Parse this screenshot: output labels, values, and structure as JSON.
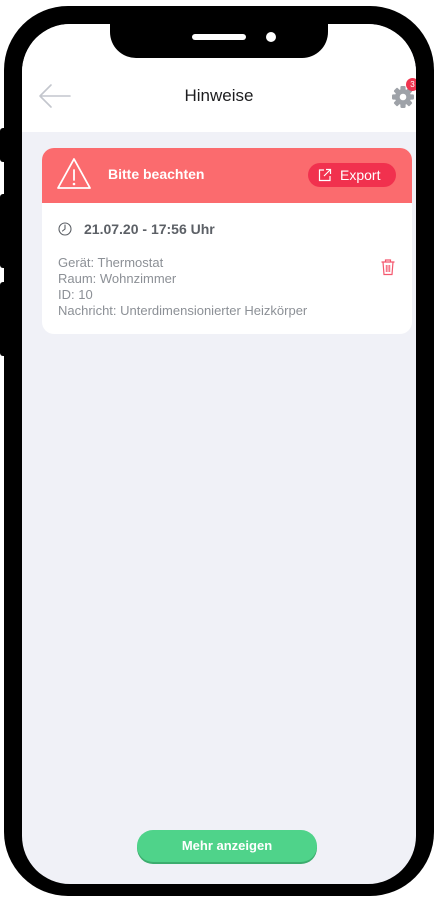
{
  "header": {
    "title": "Hinweise",
    "notification_count": "3"
  },
  "card": {
    "title": "Bitte beachten",
    "export_label": "Export",
    "timestamp": "21.07.20 - 17:56 Uhr",
    "details": [
      "Gerät: Thermostat",
      "Raum: Wohnzimmer",
      "ID: 10",
      "Nachricht: Unterdimensionierter Heizkörper"
    ]
  },
  "footer": {
    "more_label": "Mehr anzeigen"
  },
  "colors": {
    "alert_header": "#fb6b6e",
    "alert_button": "#f1314e",
    "primary_green": "#4fd38a",
    "background": "#f0f1f7"
  },
  "icons": [
    "back-arrow-icon",
    "gear-icon",
    "warning-icon",
    "external-link-icon",
    "clock-icon",
    "trash-icon"
  ]
}
